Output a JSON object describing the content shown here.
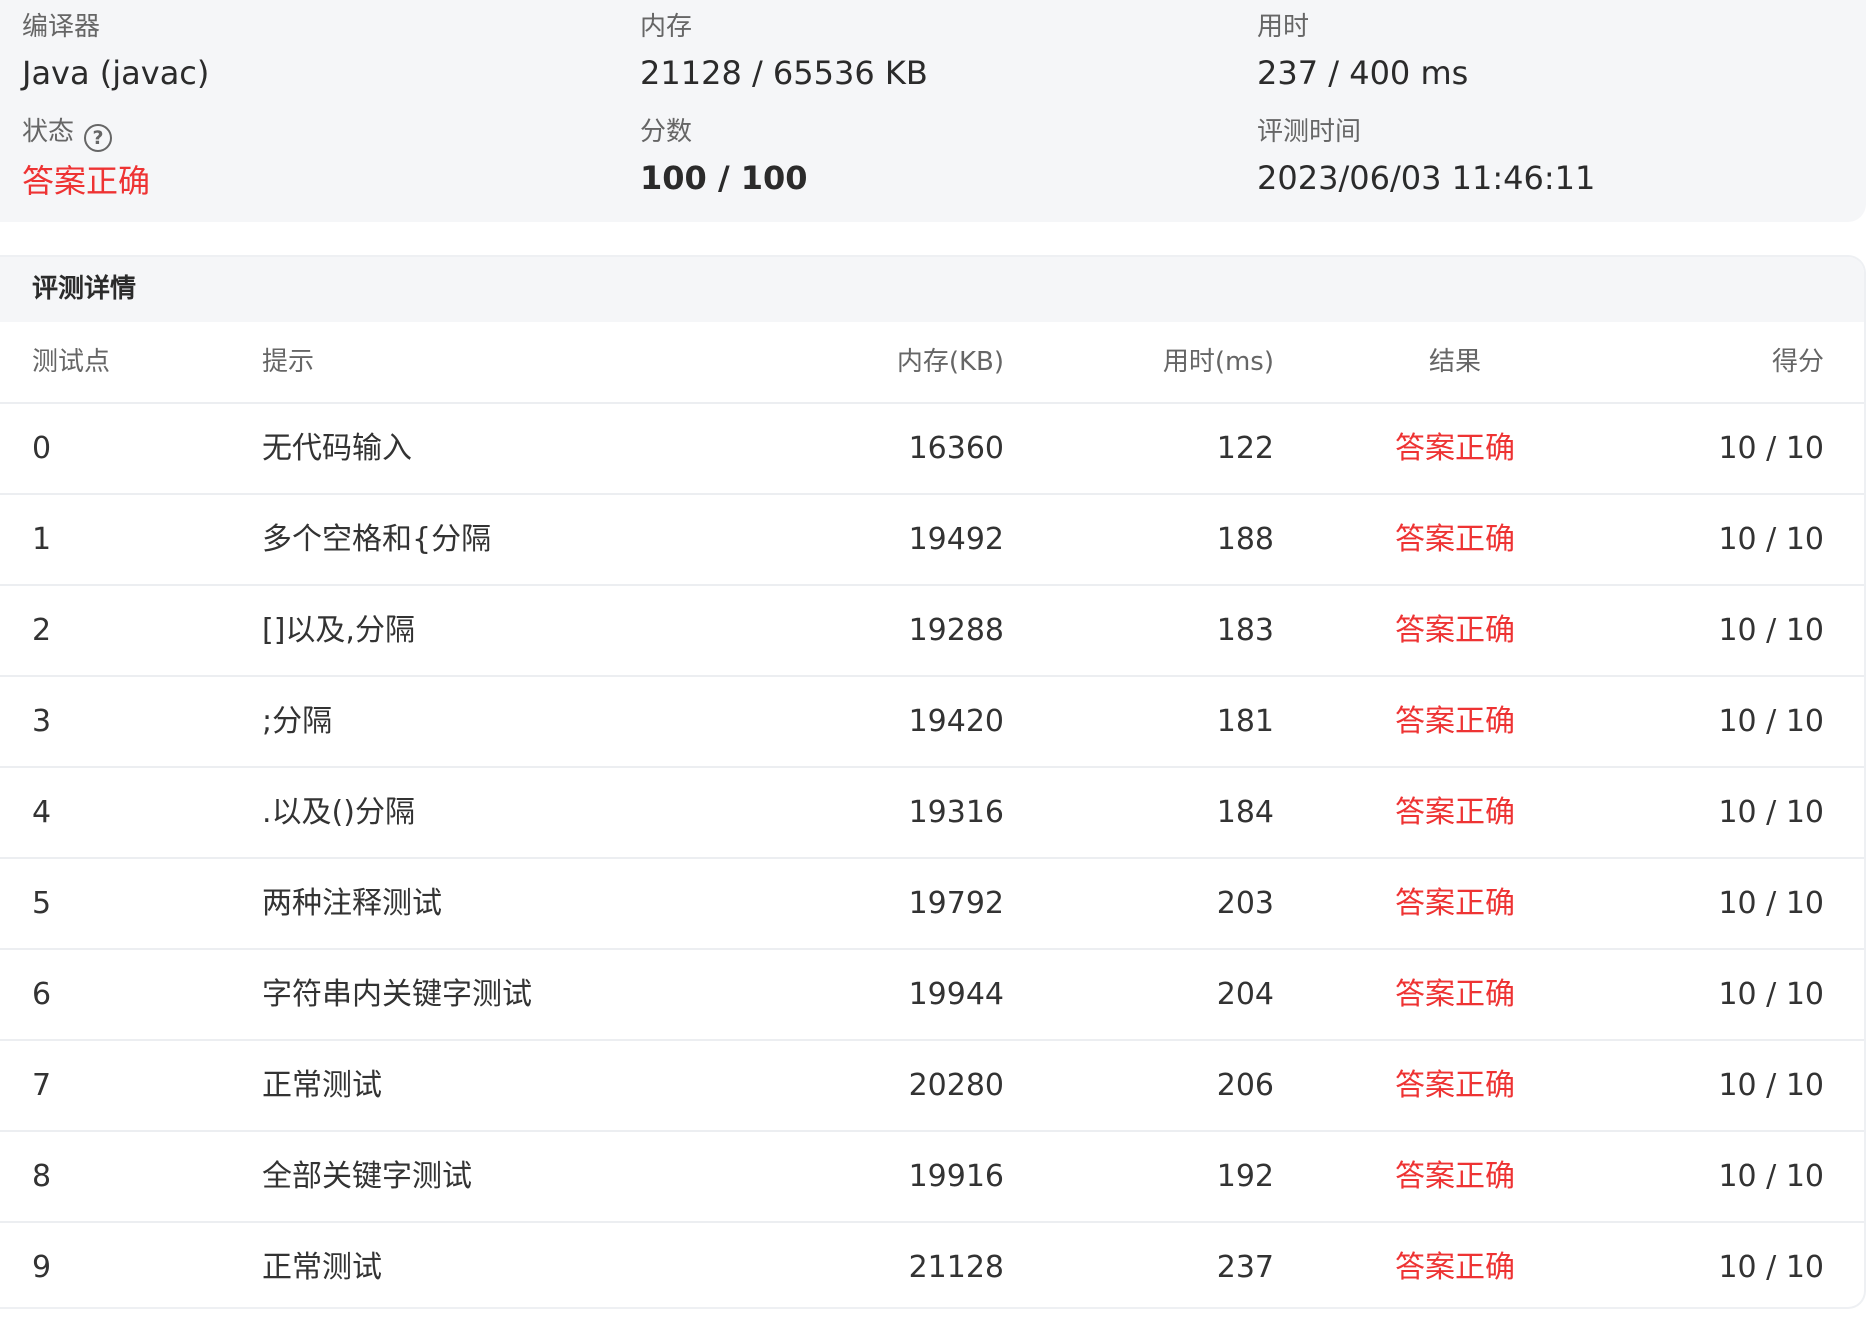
{
  "summary": {
    "compiler_label": "编译器",
    "compiler_value": "Java (javac)",
    "memory_label": "内存",
    "memory_value": "21128 / 65536 KB",
    "time_label": "用时",
    "time_value": "237 / 400 ms",
    "status_label": "状态",
    "status_value": "答案正确",
    "score_label": "分数",
    "score_value": "100 / 100",
    "judge_time_label": "评测时间",
    "judge_time_value": "2023/06/03 11:46:11"
  },
  "details": {
    "title": "评测详情",
    "columns": {
      "id": "测试点",
      "hint": "提示",
      "memory": "内存(KB)",
      "time": "用时(ms)",
      "result": "结果",
      "score": "得分"
    },
    "rows": [
      {
        "id": "0",
        "hint": "无代码输入",
        "memory": "16360",
        "time": "122",
        "result": "答案正确",
        "score": "10 / 10"
      },
      {
        "id": "1",
        "hint": "多个空格和{分隔",
        "memory": "19492",
        "time": "188",
        "result": "答案正确",
        "score": "10 / 10"
      },
      {
        "id": "2",
        "hint": "[]以及,分隔",
        "memory": "19288",
        "time": "183",
        "result": "答案正确",
        "score": "10 / 10"
      },
      {
        "id": "3",
        "hint": ";分隔",
        "memory": "19420",
        "time": "181",
        "result": "答案正确",
        "score": "10 / 10"
      },
      {
        "id": "4",
        "hint": ".以及()分隔",
        "memory": "19316",
        "time": "184",
        "result": "答案正确",
        "score": "10 / 10"
      },
      {
        "id": "5",
        "hint": "两种注释测试",
        "memory": "19792",
        "time": "203",
        "result": "答案正确",
        "score": "10 / 10"
      },
      {
        "id": "6",
        "hint": "字符串内关键字测试",
        "memory": "19944",
        "time": "204",
        "result": "答案正确",
        "score": "10 / 10"
      },
      {
        "id": "7",
        "hint": "正常测试",
        "memory": "20280",
        "time": "206",
        "result": "答案正确",
        "score": "10 / 10"
      },
      {
        "id": "8",
        "hint": "全部关键字测试",
        "memory": "19916",
        "time": "192",
        "result": "答案正确",
        "score": "10 / 10"
      },
      {
        "id": "9",
        "hint": "正常测试",
        "memory": "21128",
        "time": "237",
        "result": "答案正确",
        "score": "10 / 10"
      }
    ]
  },
  "colors": {
    "accepted": "#ee3333",
    "panel_bg": "#f5f6f8"
  }
}
